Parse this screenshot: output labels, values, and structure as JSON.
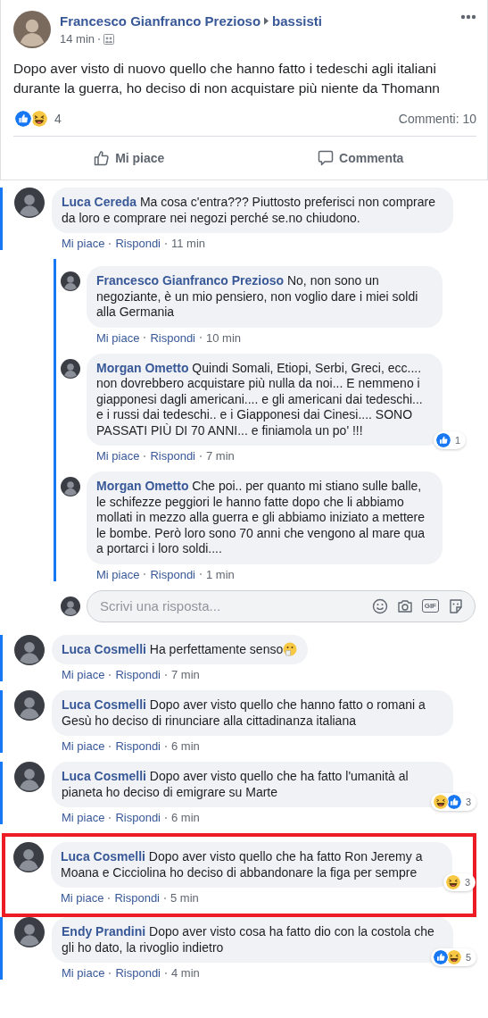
{
  "post": {
    "author": "Francesco Gianfranco Prezioso",
    "group": "bassisti",
    "time": "14 min",
    "text": "Dopo aver visto di nuovo quello che hanno fatto i tedeschi agli italiani durante la guerra, ho deciso di non acquistare più niente da Thomann",
    "reactions": [
      {
        "kind": "like"
      },
      {
        "kind": "haha"
      }
    ],
    "reaction_count": "4",
    "comment_count": "Commenti: 10",
    "actions": [
      {
        "kind": "like",
        "label": "Mi piace"
      },
      {
        "kind": "comment",
        "label": "Commenta"
      }
    ]
  },
  "comments": [
    {
      "author": "Luca Cereda",
      "text": "Ma cosa c'entra??? Piuttosto preferisci non comprare da loro e comprare nei negozi perché se.no chiudono.",
      "like": "Mi piace",
      "reply": "Rispondi",
      "time": "11 min",
      "unread": true,
      "highlighted": false,
      "replies": [
        {
          "author": "Francesco Gianfranco Prezioso",
          "text": "No, non sono un negoziante, è un mio pensiero, non voglio dare i miei soldi alla Germania",
          "like": "Mi piace",
          "reply": "Rispondi",
          "time": "10 min"
        },
        {
          "author": "Morgan Ometto",
          "text": "Quindi Somali, Etiopi, Serbi, Greci, ecc.... non dovrebbero acquistare più nulla da noi... E nemmeno i giapponesi dagli americani.... e gli americani dai tedeschi... e i russi dai tedeschi.. e i Giapponesi dai Cinesi.... SONO PASSATI PIÙ DI 70 ANNI... e finiamola un po' !!!",
          "like": "Mi piace",
          "reply": "Rispondi",
          "time": "7 min",
          "reactions": [
            {
              "kind": "like"
            }
          ],
          "reaction_count": "1"
        },
        {
          "author": "Morgan Ometto",
          "text": "Che poi.. per quanto mi stiano sulle balle, le schifezze peggiori le hanno fatte dopo che li abbiamo mollati in mezzo alla guerra e gli abbiamo iniziato a mettere le bombe. Però loro sono 70 anni che vengono al mare qua a portarci i loro soldi....",
          "like": "Mi piace",
          "reply": "Rispondi",
          "time": "1 min"
        }
      ],
      "reply_box": {
        "placeholder": "Scrivi una risposta...",
        "gif": "GIF"
      }
    },
    {
      "author": "Luca Cosmelli",
      "text": "Ha perfettamente senso",
      "has_emoji": true,
      "like": "Mi piace",
      "reply": "Rispondi",
      "time": "7 min",
      "unread": true,
      "highlighted": false
    },
    {
      "author": "Luca Cosmelli",
      "text": "Dopo aver visto quello che hanno fatto o romani a Gesù ho deciso di rinunciare alla cittadinanza italiana",
      "like": "Mi piace",
      "reply": "Rispondi",
      "time": "6 min",
      "unread": true,
      "highlighted": false
    },
    {
      "author": "Luca Cosmelli",
      "text": "Dopo aver visto quello che ha fatto l'umanità al pianeta ho deciso di emigrare su Marte",
      "like": "Mi piace",
      "reply": "Rispondi",
      "time": "6 min",
      "unread": true,
      "highlighted": false,
      "reactions": [
        {
          "kind": "haha"
        },
        {
          "kind": "like"
        }
      ],
      "reaction_count": "3"
    },
    {
      "author": "Luca Cosmelli",
      "text": "Dopo aver visto quello che ha fatto Ron Jeremy a Moana e Cicciolina ho deciso di abbandonare la figa per sempre",
      "like": "Mi piace",
      "reply": "Rispondi",
      "time": "5 min",
      "unread": true,
      "highlighted": true,
      "reactions": [
        {
          "kind": "haha"
        }
      ],
      "reaction_count": "3"
    },
    {
      "author": "Endy Prandini",
      "text": "Dopo aver visto cosa ha fatto dio con la costola che gli ho dato, la rivoglio indietro",
      "like": "Mi piace",
      "reply": "Rispondi",
      "time": "4 min",
      "unread": true,
      "highlighted": false,
      "reactions": [
        {
          "kind": "like"
        },
        {
          "kind": "haha"
        }
      ],
      "reaction_count": "5"
    }
  ]
}
